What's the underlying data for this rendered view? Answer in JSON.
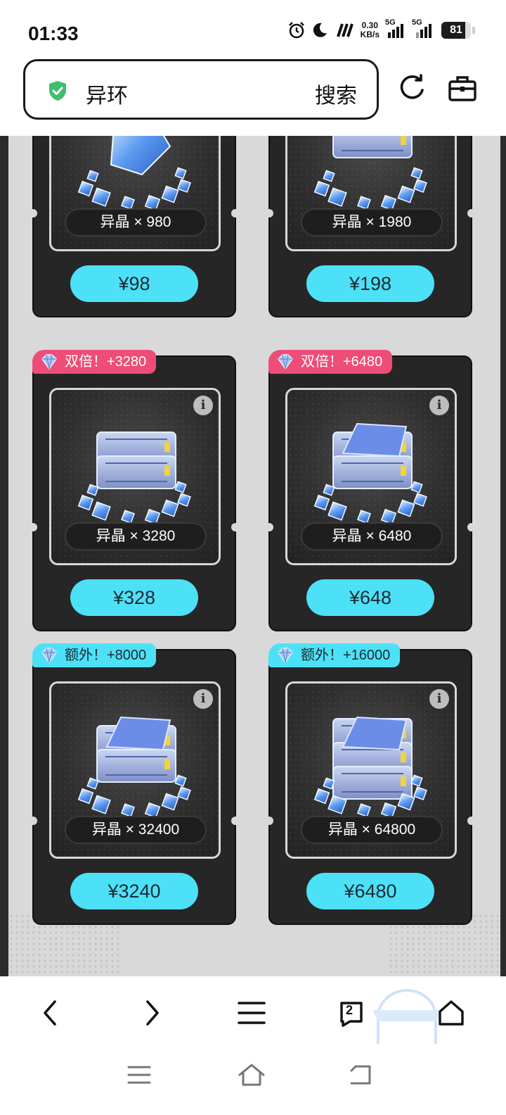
{
  "status_bar": {
    "time": "01:33",
    "net_speed_value": "0.30",
    "net_speed_unit": "KB/s",
    "sim1_label": "5G",
    "sim2_label": "5G",
    "battery_level": 81,
    "battery_text": "81"
  },
  "search": {
    "query": "异环",
    "button_label": "搜索"
  },
  "products": [
    {
      "quantity_text": "异晶 × 980",
      "price": "¥98",
      "badge": "",
      "has_info": false
    },
    {
      "quantity_text": "异晶 × 1980",
      "price": "¥198",
      "badge": "",
      "has_info": false
    },
    {
      "quantity_text": "异晶 × 3280",
      "price": "¥328",
      "badge": "双倍！+3280",
      "badge_style": "pink",
      "has_info": true
    },
    {
      "quantity_text": "异晶 × 6480",
      "price": "¥648",
      "badge": "双倍！+6480",
      "badge_style": "pink",
      "has_info": true
    },
    {
      "quantity_text": "异晶 × 32400",
      "price": "¥3240",
      "badge": "额外！+8000",
      "badge_style": "cyan",
      "has_info": true
    },
    {
      "quantity_text": "异晶 × 64800",
      "price": "¥6480",
      "badge": "额外！+16000",
      "badge_style": "cyan",
      "has_info": true
    }
  ],
  "info_glyph": "i",
  "browser_nav": {
    "tab_count": "2",
    "icons": [
      "back-icon",
      "forward-icon",
      "menu-icon",
      "tabs-icon",
      "home-icon"
    ]
  },
  "system_nav": {
    "icons": [
      "recent-apps-icon",
      "home-icon",
      "back-icon"
    ]
  },
  "colors": {
    "price_button": "#4de1f7",
    "double_badge": "#ee4d77",
    "extra_badge": "#4de1f7",
    "card_bg": "#262626",
    "shield_green": "#3cc06c"
  }
}
